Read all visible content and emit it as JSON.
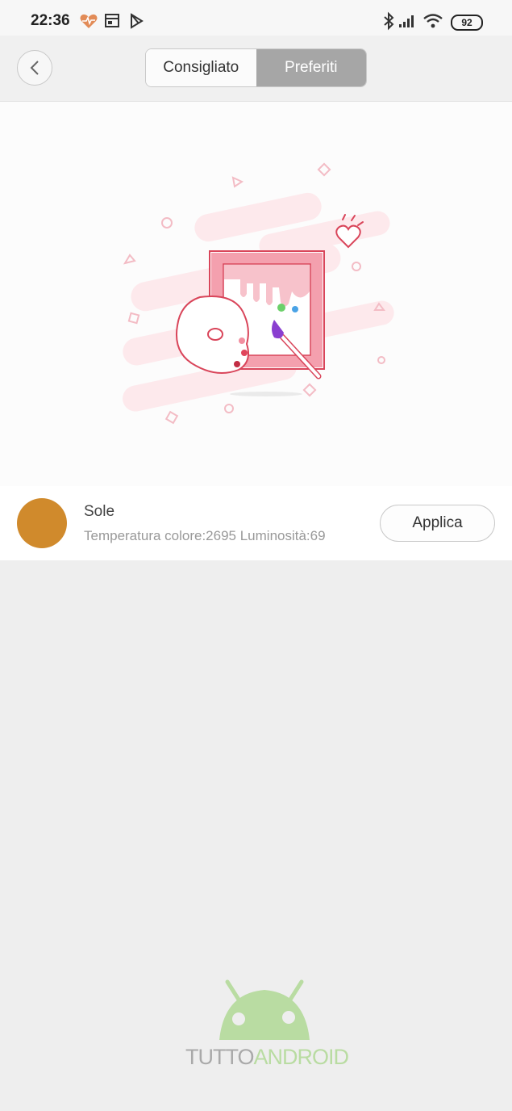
{
  "status_bar": {
    "time": "22:36",
    "battery": "92",
    "icons_left": [
      "heart-rate-icon",
      "calendar-icon",
      "play-store-icon"
    ],
    "icons_right": [
      "bluetooth-icon",
      "signal-icon",
      "wifi-icon",
      "battery-icon"
    ]
  },
  "header": {
    "back_icon": "chevron-left-icon",
    "tabs": [
      {
        "label": "Consigliato",
        "active": false
      },
      {
        "label": "Preferiti",
        "active": true
      }
    ]
  },
  "preset": {
    "name": "Sole",
    "details": "Temperatura colore:2695 Luminosità:69",
    "color": "#d08a2c",
    "apply_label": "Applica"
  },
  "watermark": {
    "part1": "TUTTO",
    "part2": "ANDROID"
  },
  "colors": {
    "accent_pink": "#ef5c6f",
    "tab_active_bg": "#a6a6a6",
    "page_bg": "#eeeeee"
  }
}
